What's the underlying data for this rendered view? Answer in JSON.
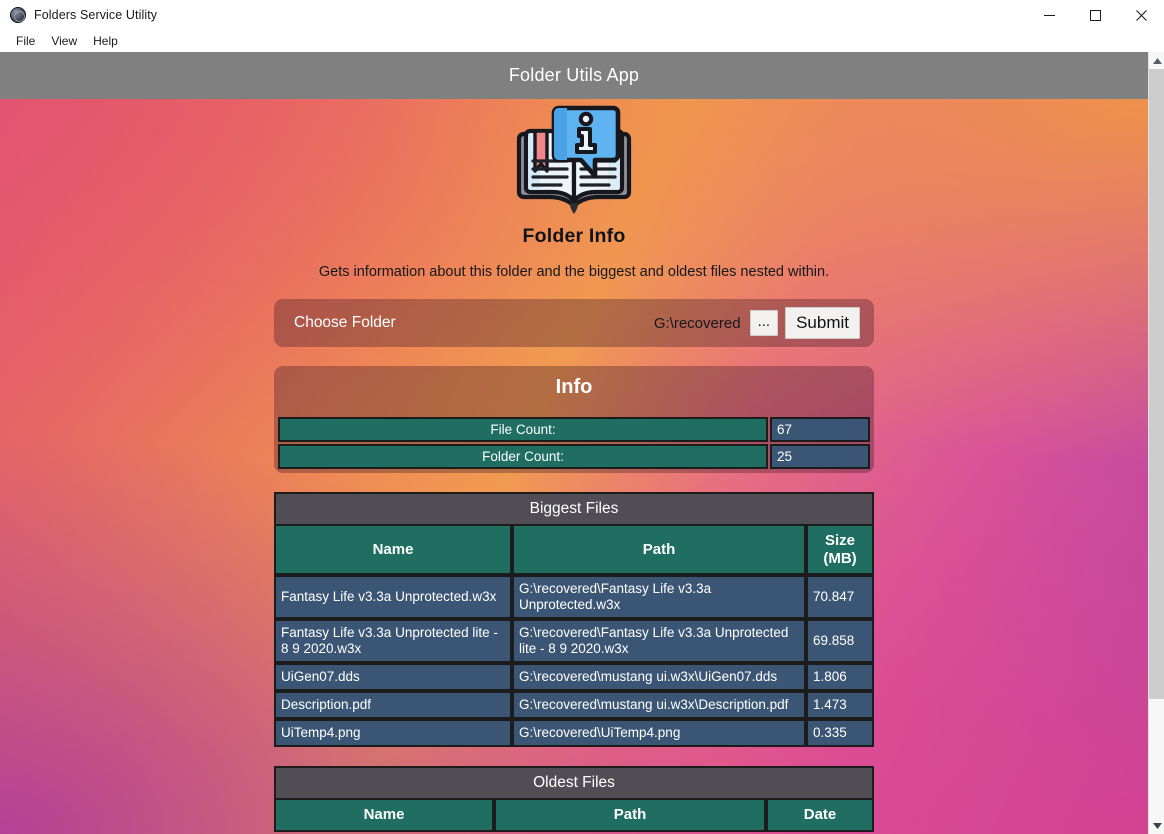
{
  "window": {
    "title": "Folders Service Utility",
    "icon": "app-icon",
    "controls": {
      "minimize": "minimize",
      "maximize": "maximize",
      "close": "close"
    }
  },
  "menubar": {
    "items": [
      "File",
      "View",
      "Help"
    ]
  },
  "app": {
    "header_title": "Folder Utils App",
    "logo_caption": "Folder Info",
    "logo_icon": "open-book-info-icon",
    "description": "Gets information about this folder and the biggest and oldest files nested within."
  },
  "chooser": {
    "label": "Choose Folder",
    "path": "G:\\recovered",
    "browse_label": "...",
    "submit_label": "Submit"
  },
  "info": {
    "title": "Info",
    "rows": [
      {
        "label": "File Count:",
        "value": "67"
      },
      {
        "label": "Folder Count:",
        "value": "25"
      }
    ]
  },
  "biggest_files": {
    "title": "Biggest Files",
    "columns": [
      "Name",
      "Path",
      "Size\n(MB)"
    ],
    "columns_flat": [
      "Name",
      "Path",
      "Size (MB)"
    ],
    "rows": [
      {
        "name": "Fantasy Life v3.3a Unprotected.w3x",
        "path": "G:\\recovered\\Fantasy Life v3.3a Unprotected.w3x",
        "size": "70.847"
      },
      {
        "name": "Fantasy Life v3.3a Unprotected lite - 8 9 2020.w3x",
        "path": "G:\\recovered\\Fantasy Life v3.3a Unprotected lite - 8 9 2020.w3x",
        "size": "69.858"
      },
      {
        "name": "UiGen07.dds",
        "path": "G:\\recovered\\mustang ui.w3x\\UiGen07.dds",
        "size": "1.806"
      },
      {
        "name": "Description.pdf",
        "path": "G:\\recovered\\mustang ui.w3x\\Description.pdf",
        "size": "1.473"
      },
      {
        "name": "UiTemp4.png",
        "path": "G:\\recovered\\UiTemp4.png",
        "size": "0.335"
      }
    ]
  },
  "oldest_files": {
    "title": "Oldest Files",
    "columns": [
      "Name",
      "Path",
      "Date"
    ],
    "rows": []
  },
  "scrollbar": {
    "up_arrow": "scroll-up-arrow",
    "down_arrow": "scroll-down-arrow",
    "thumb": "scroll-thumb"
  },
  "colors": {
    "header_bar": "#808080",
    "teal": "#1f6e61",
    "slate": "#3b5674",
    "section_gray": "#514d55",
    "panel_overlay": "rgba(60,22,38,.34)"
  }
}
